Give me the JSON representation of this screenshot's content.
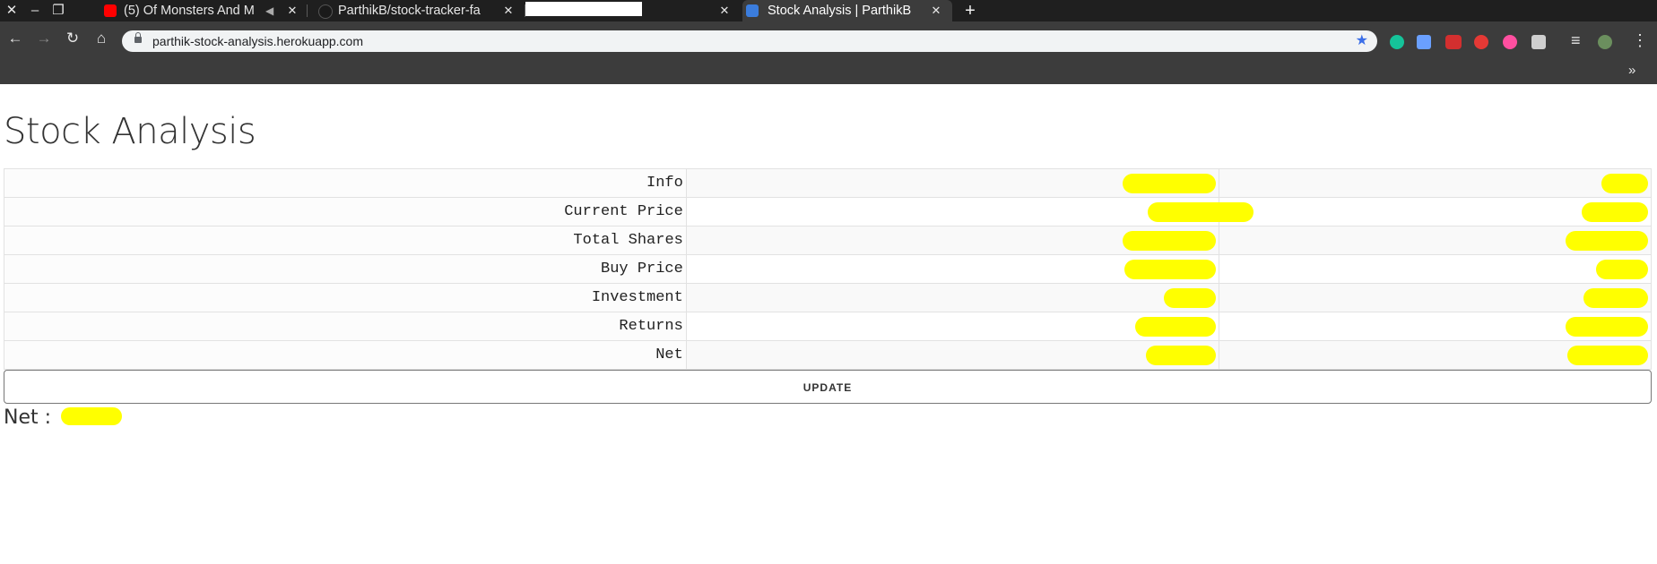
{
  "browser": {
    "tabs": [
      {
        "title": "(5) Of Monsters And M",
        "favicon": "youtube-icon",
        "icon_color": "#ff0000",
        "audio": true,
        "active": false
      },
      {
        "title": "ParthikB/stock-tracker-fa",
        "favicon": "github-icon",
        "icon_color": "#1f1f1f",
        "active": false
      },
      {
        "title": "",
        "favicon": "",
        "active": false
      },
      {
        "title": "Stock Analysis | ParthikB",
        "favicon": "chart-icon",
        "icon_color": "#3b7ddd",
        "active": true
      }
    ],
    "url": "parthik-stock-analysis.herokuapp.com"
  },
  "page": {
    "title": "Stock Analysis",
    "rows": [
      {
        "label": "Info"
      },
      {
        "label": "Current Price"
      },
      {
        "label": "Total Shares"
      },
      {
        "label": "Buy Price"
      },
      {
        "label": "Investment"
      },
      {
        "label": "Returns"
      },
      {
        "label": "Net"
      }
    ],
    "update_label": "UPDATE",
    "net_label": "Net :",
    "redaction_color": "#ffff00"
  }
}
